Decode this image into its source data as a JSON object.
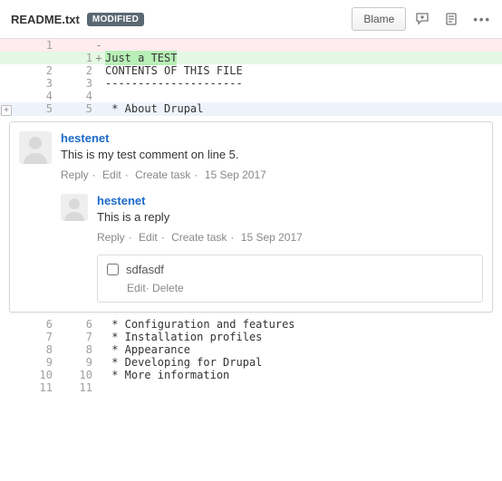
{
  "header": {
    "filename": "README.txt",
    "badge": "MODIFIED",
    "blame": "Blame"
  },
  "diff": {
    "rows": [
      {
        "old": "1",
        "new": "",
        "sign": "-",
        "text": "",
        "cls": "del"
      },
      {
        "old": "",
        "new": "1",
        "sign": "+",
        "text": "Just a TEST",
        "cls": "add",
        "hl": true
      },
      {
        "old": "2",
        "new": "2",
        "sign": "",
        "text": "CONTENTS OF THIS FILE"
      },
      {
        "old": "3",
        "new": "3",
        "sign": "",
        "text": "---------------------"
      },
      {
        "old": "4",
        "new": "4",
        "sign": "",
        "text": ""
      },
      {
        "old": "5",
        "new": "5",
        "sign": "",
        "text": " * About Drupal",
        "cls": "hl-row",
        "gutter": true
      }
    ],
    "rows_after": [
      {
        "old": "6",
        "new": "6",
        "text": " * Configuration and features"
      },
      {
        "old": "7",
        "new": "7",
        "text": " * Installation profiles"
      },
      {
        "old": "8",
        "new": "8",
        "text": " * Appearance"
      },
      {
        "old": "9",
        "new": "9",
        "text": " * Developing for Drupal"
      },
      {
        "old": "10",
        "new": "10",
        "text": " * More information"
      },
      {
        "old": "11",
        "new": "11",
        "text": ""
      }
    ]
  },
  "actions": {
    "reply": "Reply",
    "edit": "Edit",
    "create_task": "Create task",
    "delete": "Delete"
  },
  "comments": {
    "c1": {
      "user": "hestenet",
      "text": "This is my test comment on line 5.",
      "date": "15 Sep 2017"
    },
    "c2": {
      "user": "hestenet",
      "text": "This is a reply",
      "date": "15 Sep 2017"
    },
    "task": {
      "text": "sdfasdf"
    }
  }
}
